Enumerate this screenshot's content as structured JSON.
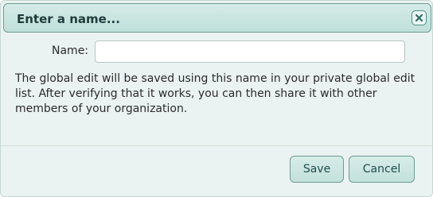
{
  "dialog": {
    "title": "Enter a name...",
    "close_icon": "close-icon"
  },
  "form": {
    "name_label": "Name:",
    "name_value": "",
    "name_placeholder": ""
  },
  "description": "The global edit will be saved using this name in your private global edit list. After verifying that it works, you can then share it with other members of your organization.",
  "buttons": {
    "save_label": "Save",
    "cancel_label": "Cancel"
  },
  "colors": {
    "accent": "#1f4d4a",
    "title_bar": "#c9e6e0",
    "background": "#eaf3f1"
  }
}
